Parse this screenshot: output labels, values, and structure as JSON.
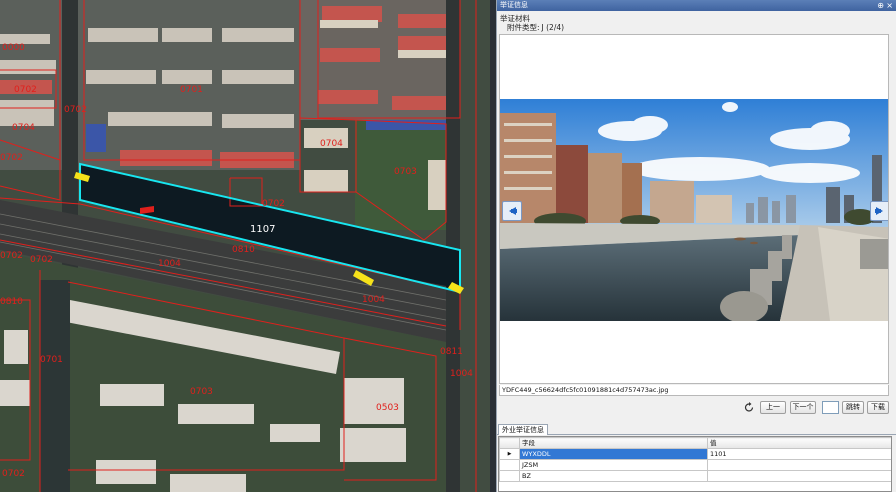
{
  "panel": {
    "title": "举证信息",
    "pin_glyph": "⊕",
    "close_glyph": "×",
    "section_label": "举证材料",
    "attachment_type_label": "附件类型:",
    "attachment_type_value": "J (2/4)"
  },
  "viewer": {
    "filename": "YDFC449_c56624dfc5fc01091881c4d757473ac.jpg",
    "prev_icon": "arrow-left-icon",
    "next_icon": "arrow-right-icon"
  },
  "controls": {
    "refresh_icon": "refresh-icon",
    "prev_label": "上一",
    "next_label": "下一个",
    "page_value": "",
    "jump_label": "跳转",
    "download_label": "下载"
  },
  "tabs": [
    {
      "label": "外业举证信息",
      "active": true
    }
  ],
  "grid": {
    "columns": [
      "字段",
      "值"
    ],
    "rows": [
      {
        "indicator": "▶",
        "field": "WYXDDL",
        "value": "1101",
        "selected": true
      },
      {
        "indicator": "",
        "field": "JZSM",
        "value": "",
        "selected": false
      },
      {
        "indicator": "",
        "field": "BZ",
        "value": "",
        "selected": false
      }
    ]
  },
  "map": {
    "selected_parcel": "1107",
    "labels": [
      "0000",
      "0702",
      "0701",
      "0702",
      "0704",
      "0702",
      "0704",
      "0703",
      "0702",
      "1107",
      "1004",
      "0810",
      "0702",
      "0702",
      "1004",
      "0701",
      "0811",
      "0703",
      "1004",
      "0503",
      "0810",
      "0702"
    ],
    "colors": {
      "boundary": "#e0201c",
      "selected_outline": "#18e6f0",
      "marker": "#f6e21a",
      "river": "#0d1a22"
    }
  }
}
